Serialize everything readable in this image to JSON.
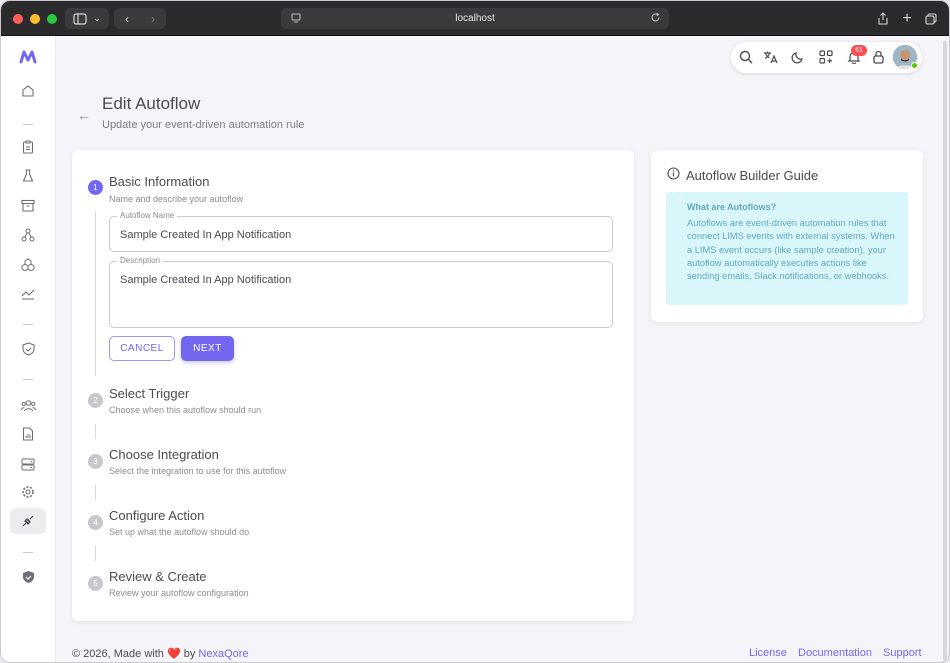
{
  "browser": {
    "url": "localhost"
  },
  "header": {
    "notification_count": "61"
  },
  "page": {
    "title": "Edit Autoflow",
    "subtitle": "Update your event-driven automation rule"
  },
  "steps": [
    {
      "num": "1",
      "title": "Basic Information",
      "subtitle": "Name and describe your autoflow"
    },
    {
      "num": "2",
      "title": "Select Trigger",
      "subtitle": "Choose when this autoflow should run"
    },
    {
      "num": "3",
      "title": "Choose Integration",
      "subtitle": "Select the integration to use for this autoflow"
    },
    {
      "num": "4",
      "title": "Configure Action",
      "subtitle": "Set up what the autoflow should do"
    },
    {
      "num": "5",
      "title": "Review & Create",
      "subtitle": "Review your autoflow configuration"
    }
  ],
  "form": {
    "name_label": "Autoflow Name",
    "name_value": "Sample Created In App Notification",
    "desc_label": "Description",
    "desc_value": "Sample Created In App Notification",
    "cancel_label": "CANCEL",
    "next_label": "NEXT"
  },
  "guide": {
    "title": "Autoflow Builder Guide",
    "heading": "What are Autoflows?",
    "body": "Autoflows are event-driven automation rules that connect LIMS events with external systems. When a LIMS event occurs (like sample creation), your autoflow automatically executes actions like sending emails, Slack notifications, or webhooks."
  },
  "footer": {
    "copyright": "© 2026, Made with",
    "by": "by",
    "brand": "NexaQore",
    "links": [
      "License",
      "Documentation",
      "Support"
    ]
  },
  "colors": {
    "primary": "#7367f0",
    "info_bg": "#d9f6fb",
    "info_text": "#62a9bb",
    "badge": "#ff4c51"
  }
}
